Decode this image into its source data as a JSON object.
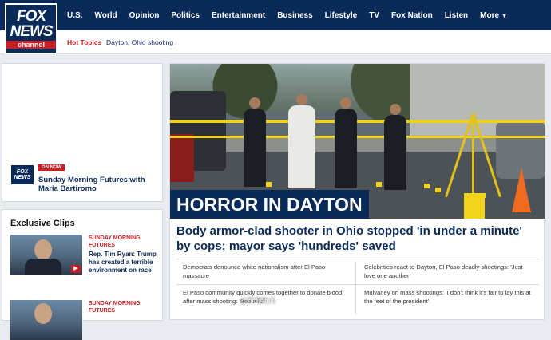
{
  "logo": {
    "line1": "FOX",
    "line2": "NEWS",
    "line3": "channel"
  },
  "nav": {
    "items": [
      "U.S.",
      "World",
      "Opinion",
      "Politics",
      "Entertainment",
      "Business",
      "Lifestyle",
      "TV",
      "Fox Nation",
      "Listen"
    ],
    "more_label": "More"
  },
  "subnav": {
    "hot_label": "Hot Topics",
    "hot_link": "Dayton, Ohio shooting"
  },
  "promo": {
    "logo_top": "FOX",
    "logo_bottom": "NEWS",
    "badge": "ON NOW",
    "show": "Sunday Morning Futures with Maria Bartiromo"
  },
  "exclusive": {
    "title": "Exclusive Clips",
    "clips": [
      {
        "show": "SUNDAY MORNING FUTURES",
        "headline": "Rep. Tim Ryan: Trump has created a terrible environment on race"
      },
      {
        "show": "SUNDAY MORNING FUTURES",
        "headline": ""
      }
    ]
  },
  "hero": {
    "banner": "HORROR IN DAYTON",
    "headline": "Body armor-clad shooter in Ohio stopped 'in under a minute' by cops; mayor says 'hundreds' saved"
  },
  "related": [
    "Democrats denounce white nationalism after El Paso massacre",
    "Celebrities react to Dayton, El Paso deadly shootings: 'Just love one another'",
    "El Paso community quickly comes together to donate blood after mass shooting: 'Beautiful'",
    "Mulvaney on mass shootings: 'I don't think it's fair to lay this at the feet of the president'"
  ],
  "watermark": "@新浪新闻",
  "colors": {
    "brand_navy": "#0a2a5a",
    "brand_red": "#c81d25",
    "tape_yellow": "#f1d21a"
  }
}
